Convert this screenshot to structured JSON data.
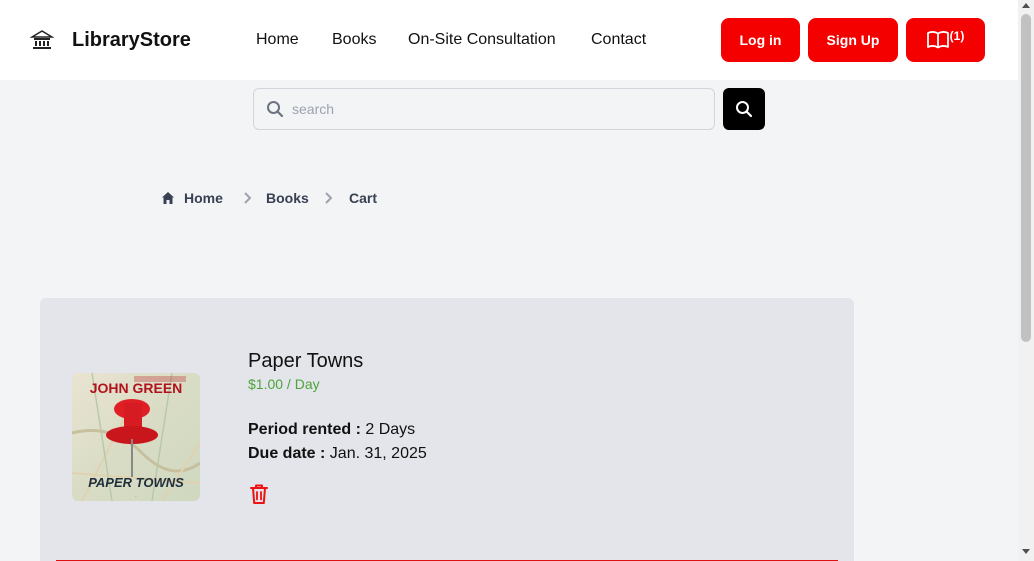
{
  "header": {
    "brand": "LibraryStore",
    "logo_icon": "library-logo-icon",
    "nav": [
      "Home",
      "Books",
      "On-Site Consultation",
      "Contact"
    ],
    "login_label": "Log in",
    "signup_label": "Sign Up",
    "cart_icon": "open-book-icon",
    "cart_count": "(1)",
    "accent_color": "#f50000"
  },
  "search": {
    "placeholder": "search",
    "value": "",
    "icon": "search-icon",
    "button_icon": "search-icon"
  },
  "breadcrumb": {
    "home_icon": "home-icon",
    "items": [
      "Home",
      "Books",
      "Cart"
    ]
  },
  "cart_item": {
    "title": "Paper Towns",
    "price": "$1.00 / Day",
    "period_label": "Period rented :",
    "period_value": "2 Days",
    "due_label": "Due date :",
    "due_value": "Jan. 31, 2025",
    "delete_icon": "trash-icon",
    "cover": {
      "author": "JOHN GREEN",
      "title": "PAPER TOWNS"
    }
  }
}
